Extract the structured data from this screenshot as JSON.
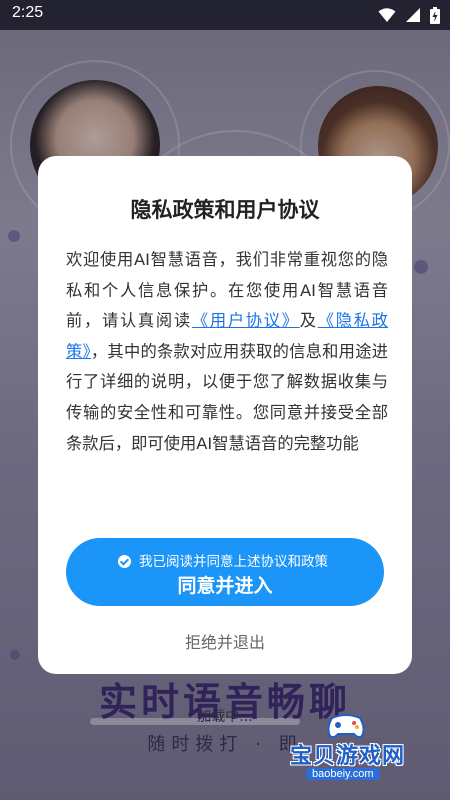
{
  "status_bar": {
    "time": "2:25",
    "icons": [
      "wifi-icon",
      "signal-icon",
      "battery-icon"
    ]
  },
  "background": {
    "slogan": "实时语音畅聊",
    "loading": "加载中...",
    "sub_slogan": "随时拨打 · 即"
  },
  "dialog": {
    "title": "隐私政策和用户协议",
    "body": {
      "part1": "欢迎使用AI智慧语音，我们非常重视您的隐私和个人信息保护。在您使用AI智慧语音前，请认真阅读",
      "link_user": "《用户协议》",
      "part2": "及",
      "link_privacy": "《隐私政策》",
      "part3": "，其中的条款对应用获取的信息和用途进行了详细的说明，以便于您了解数据收集与传输的安全性和可靠性。您同意并接受全部条款后，即可使用AI智慧语音的完整功能"
    },
    "agree_checkbox_label": "我已阅读并同意上述协议和政策",
    "agree_button_label": "同意并进入",
    "reject_label": "拒绝并退出"
  },
  "watermark": {
    "text": "宝贝游戏网",
    "url": "baobeiy.com"
  },
  "colors": {
    "accent": "#1b95f8",
    "link": "#1a73e8",
    "overlay": "#14122359"
  }
}
